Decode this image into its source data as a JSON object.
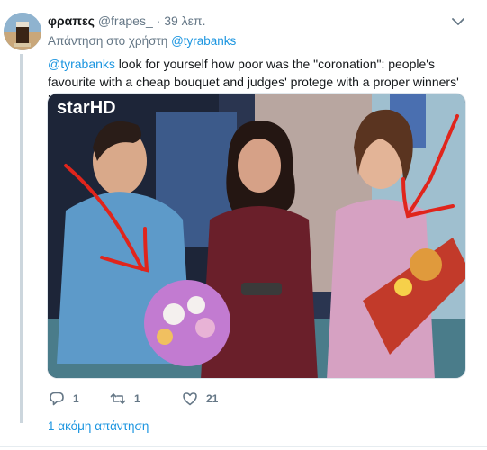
{
  "tweet": {
    "display_name": "φραπες",
    "handle": "@frapes_",
    "separator": "·",
    "time": "39 λεπ.",
    "reply_prefix": "Απάντηση στο χρήστη",
    "reply_to": "@tyrabanks",
    "text_mention": "@tyrabanks",
    "text_body": " look for yourself how poor was the   \"coronation\": people's favourite with a cheap bouquet and judges' protege with a proper winners' bouquet",
    "media_logo": "starHD"
  },
  "actions": {
    "reply_count": "1",
    "retweet_count": "1",
    "like_count": "21"
  },
  "more_replies": "1 ακόμη απάντηση",
  "icons": {
    "menu": "chevron-down-icon",
    "reply": "reply-icon",
    "retweet": "retweet-icon",
    "like": "heart-icon"
  },
  "colors": {
    "link": "#1b95e0",
    "muted": "#657786",
    "text": "#14171a"
  }
}
